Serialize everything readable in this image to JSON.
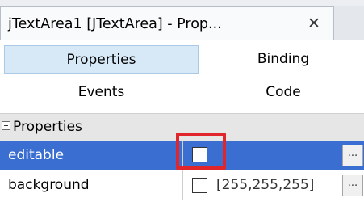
{
  "window": {
    "title": "jTextArea1 [JTextArea] - Prop...",
    "close_glyph": "✕"
  },
  "tabs": [
    {
      "label": "Properties",
      "active": true
    },
    {
      "label": "Binding",
      "active": false
    },
    {
      "label": "Events",
      "active": false
    },
    {
      "label": "Code",
      "active": false
    }
  ],
  "section": {
    "label": "Properties",
    "collapse_icon": "minus-box-icon"
  },
  "properties": [
    {
      "name": "editable",
      "checked": false,
      "value": "",
      "selected": true,
      "button": "..."
    },
    {
      "name": "background",
      "checked": false,
      "value": "[255,255,255]",
      "selected": false,
      "button": "..."
    }
  ],
  "colors": {
    "selection": "#3a6ed0",
    "active_tab": "#d7e9f7",
    "highlight": "#e0262b"
  }
}
